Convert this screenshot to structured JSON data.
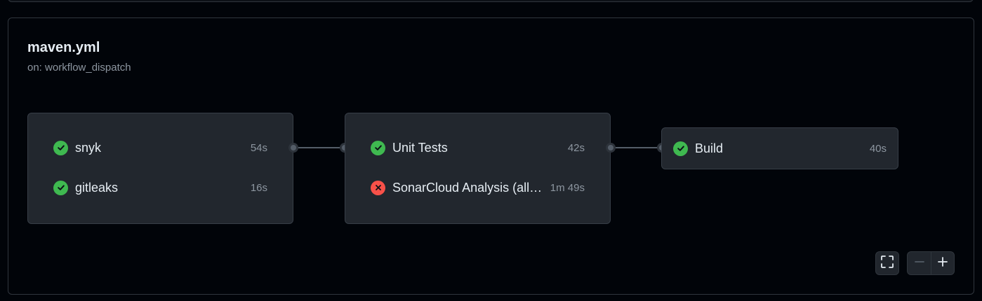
{
  "workflow": {
    "title": "maven.yml",
    "trigger": "on: workflow_dispatch"
  },
  "stages": [
    {
      "jobs": [
        {
          "name": "snyk",
          "duration": "54s",
          "status": "success"
        },
        {
          "name": "gitleaks",
          "duration": "16s",
          "status": "success"
        }
      ]
    },
    {
      "jobs": [
        {
          "name": "Unit Tests",
          "duration": "42s",
          "status": "success"
        },
        {
          "name": "SonarCloud Analysis (all…",
          "duration": "1m 49s",
          "status": "failure"
        }
      ]
    },
    {
      "jobs": [
        {
          "name": "Build",
          "duration": "40s",
          "status": "success"
        }
      ]
    }
  ],
  "colors": {
    "success": "#3fb950",
    "failure": "#f85149",
    "background": "#010409",
    "card": "#22272e"
  },
  "icons": {
    "success": "check-circle-icon",
    "failure": "x-circle-icon",
    "fullscreen": "fullscreen-icon",
    "zoom_out": "minus-icon",
    "zoom_in": "plus-icon"
  }
}
